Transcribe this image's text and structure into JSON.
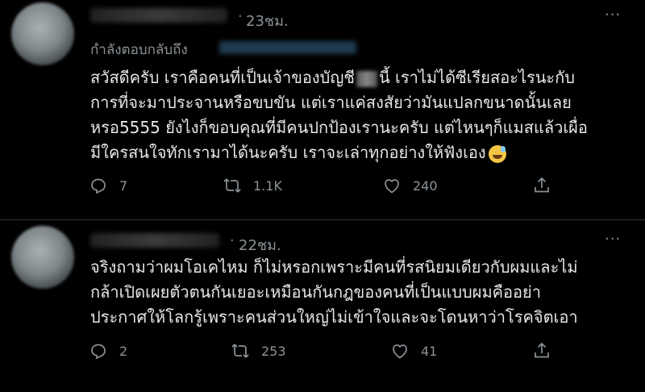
{
  "tweets": [
    {
      "time": "23ชม.",
      "separator": "·",
      "more": "···",
      "reply_prefix": "กำลังตอบกลับถึง",
      "text_lines": [
        [
          "สวัสดีครับ เราคือคนที่เป็นเจ้าของบัญชี",
          "นี้ เราไม่ได้ซีเรียสอะไรนะกับ"
        ],
        [
          "การที่จะมาประจานหรือขบขัน แต่เราแค่สงสัยว่ามันแปลกขนาดนั้นเลย"
        ],
        [
          "หรอ5555 ยังไงก็ขอบคุณที่มีคนปกป้องเรานะครับ แต่ไหนๆก็แมสแล้วเผื่อ"
        ],
        [
          "มีใครสนใจทักเรามาได้นะครับ เราจะเล่าทุกอย่างให้ฟังเอง"
        ]
      ],
      "emoji": "sweat-smile-emoji",
      "replies": "7",
      "retweets": "1.1K",
      "likes": "240"
    },
    {
      "time": "22ชม.",
      "separator": "·",
      "more": "···",
      "text_lines": [
        "จริงถามว่าผมโอเคไหม ก็ไม่หรอกเพราะมีคนที่รสนิยมเดียวกับผมและไม่",
        "กล้าเปิดเผยตัวตนกันเยอะเหมือนกันกฎของคนที่เป็นแบบผมคืออย่า",
        "ประกาศให้โลกรู้เพราะคนส่วนใหญ่ไม่เข้าใจและจะโดนหาว่าโรคจิตเอา"
      ],
      "replies": "2",
      "retweets": "253",
      "likes": "41"
    }
  ],
  "colors": {
    "background": "#000000",
    "text": "#e6e6e6",
    "muted": "#8b9297",
    "divider": "#2f3336"
  },
  "icons": [
    "reply-icon",
    "retweet-icon",
    "like-icon",
    "share-icon"
  ]
}
